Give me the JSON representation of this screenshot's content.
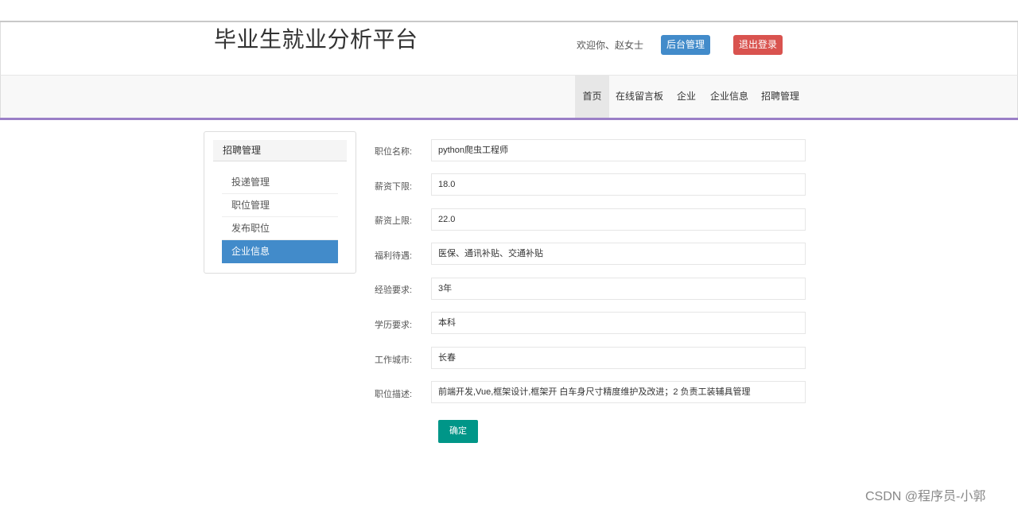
{
  "header": {
    "site_title": "毕业生就业分析平台",
    "welcome": "欢迎你、赵女士",
    "admin_button": "后台管理",
    "logout_button": "退出登录"
  },
  "nav": {
    "items": [
      "首页",
      "在线留言板",
      "企业",
      "企业信息",
      "招聘管理"
    ],
    "active_index": 0
  },
  "sidebar": {
    "title": "招聘管理",
    "items": [
      "投递管理",
      "职位管理",
      "发布职位",
      "企业信息"
    ],
    "active_index": 3
  },
  "form": {
    "fields": [
      {
        "label": "职位名称:",
        "value": "python爬虫工程师"
      },
      {
        "label": "薪资下限:",
        "value": "18.0"
      },
      {
        "label": "薪资上限:",
        "value": "22.0"
      },
      {
        "label": "福利待遇:",
        "value": "医保、通讯补贴、交通补贴"
      },
      {
        "label": "经验要求:",
        "value": "3年"
      },
      {
        "label": "学历要求:",
        "value": "本科"
      },
      {
        "label": "工作城市:",
        "value": "长春"
      },
      {
        "label": "职位描述:",
        "value": "前端开发,Vue,框架设计,框架开 白车身尺寸精度维护及改进；2 负责工装辅具管理"
      }
    ],
    "submit_label": "确定"
  },
  "watermark": "CSDN @程序员-小郭",
  "colors": {
    "primary": "#428bca",
    "danger": "#d9534f",
    "confirm": "#009688",
    "nav_accent": "#9b7fc7"
  }
}
